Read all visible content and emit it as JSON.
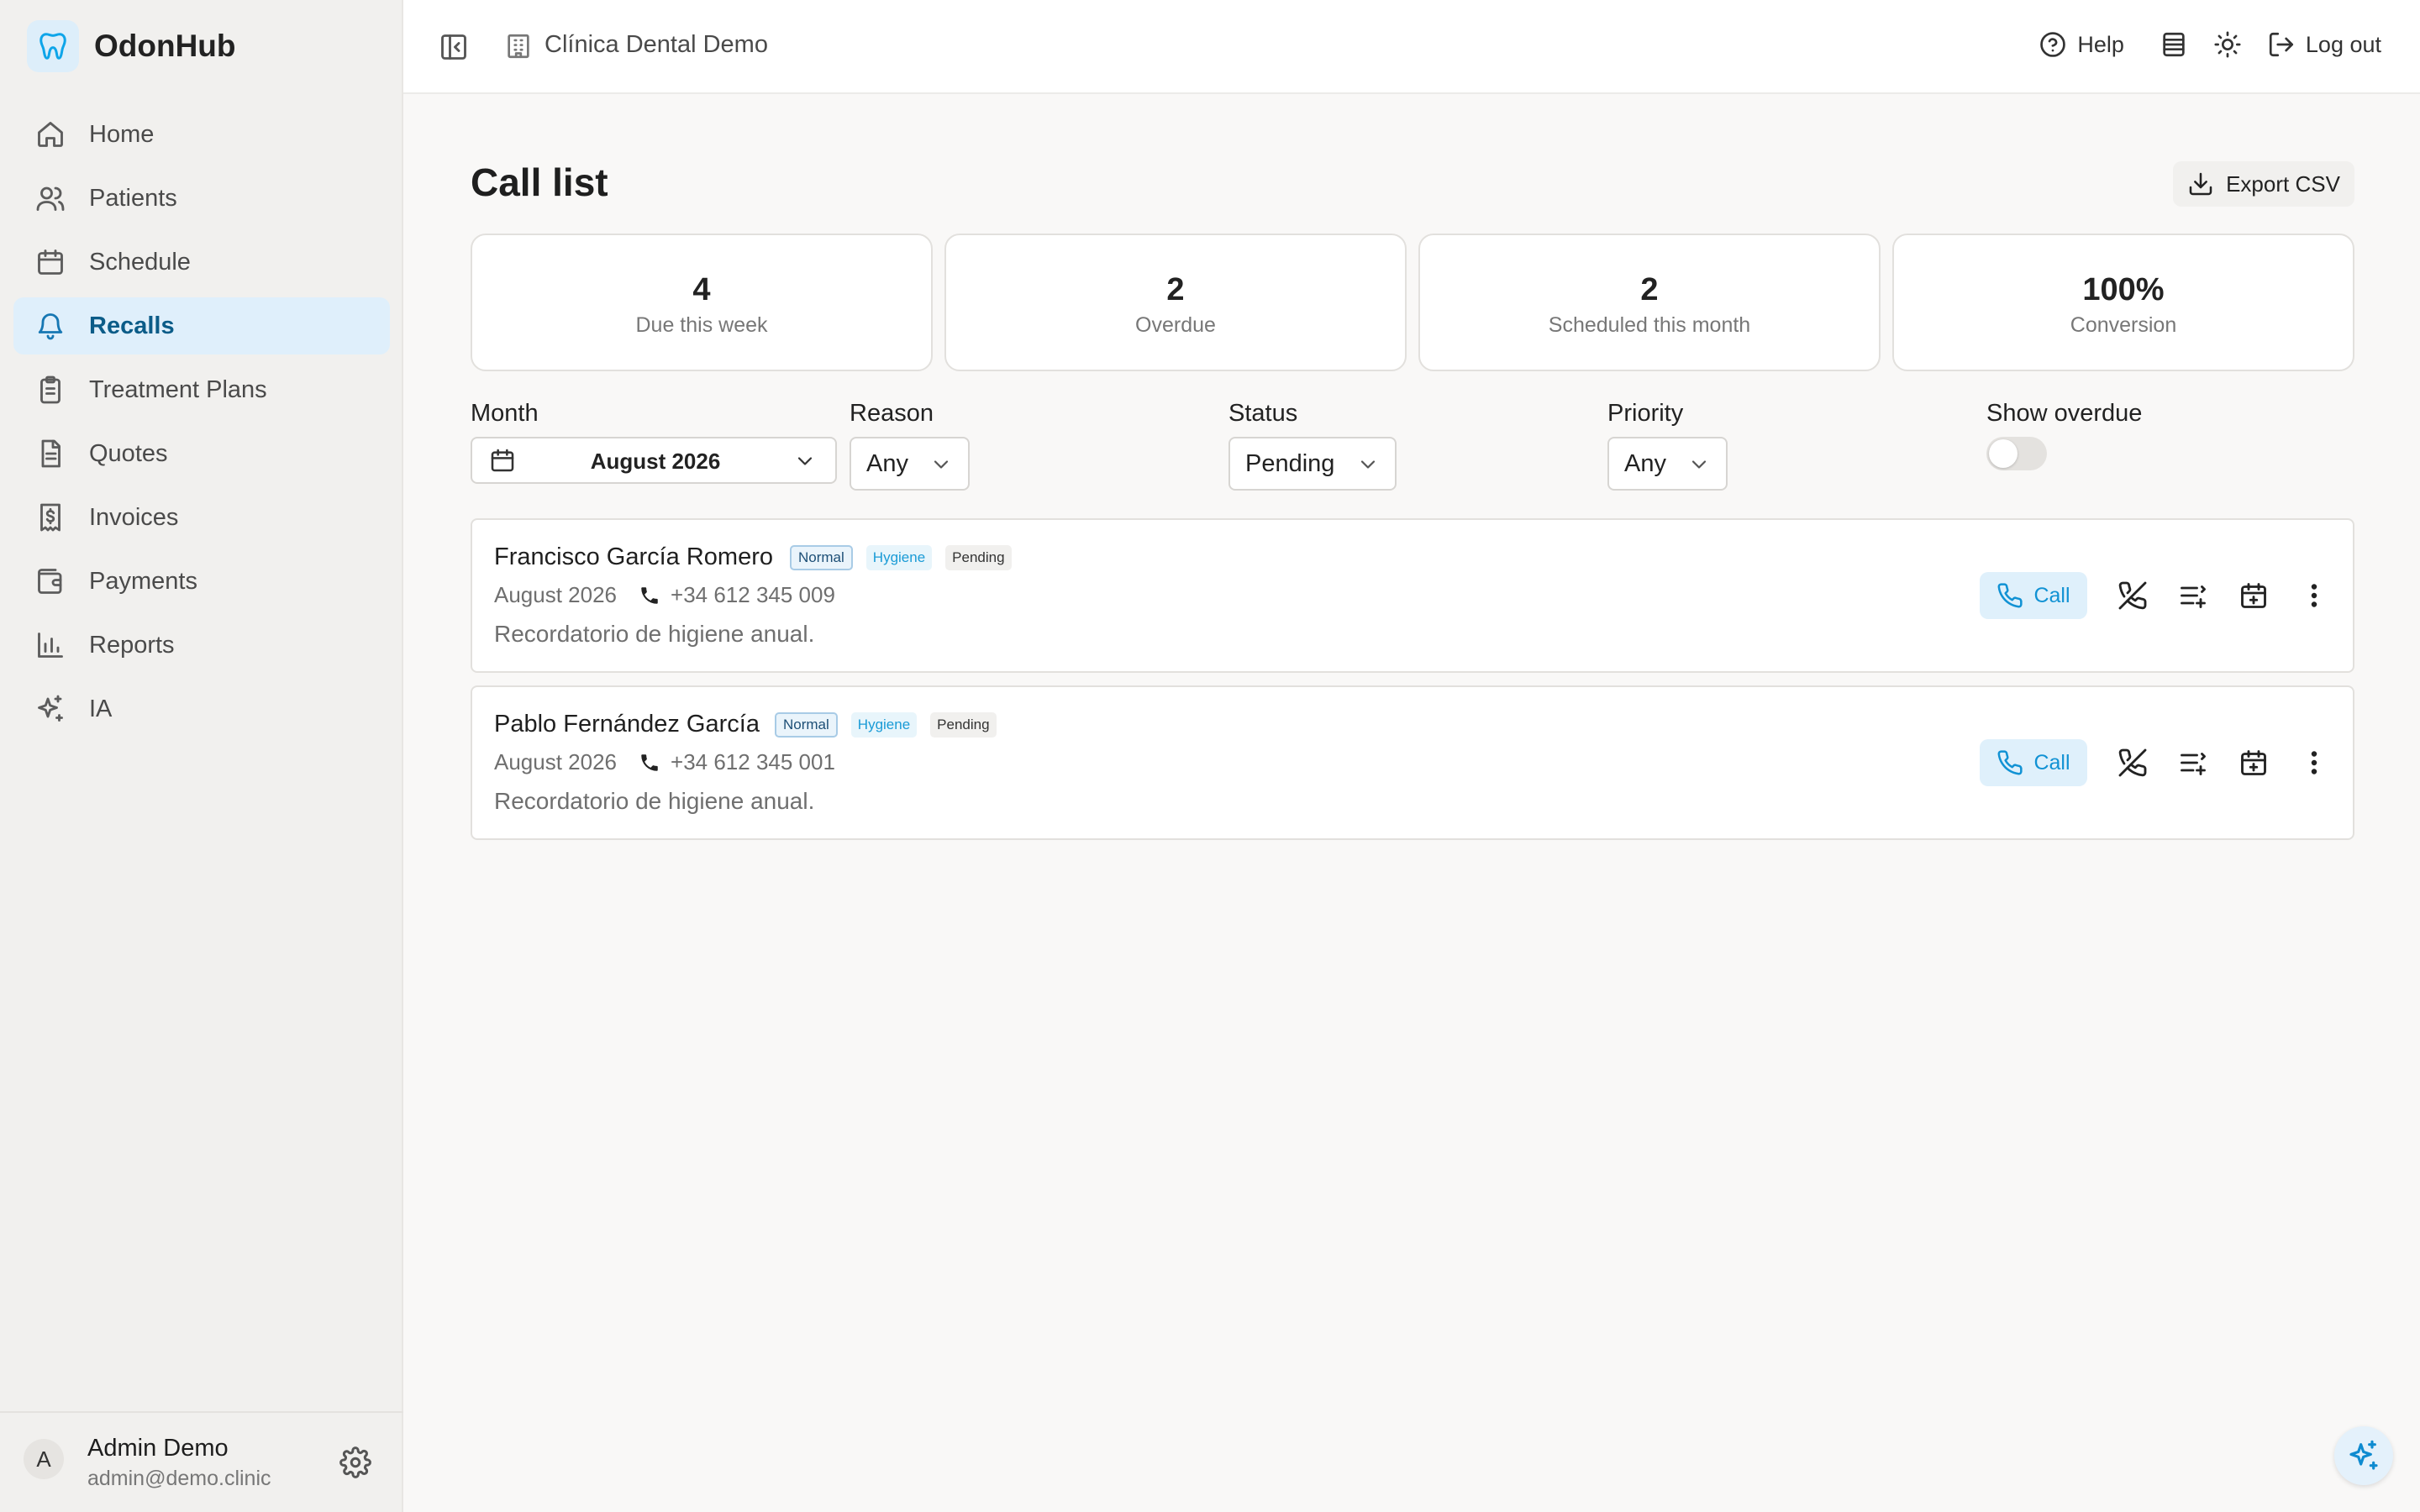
{
  "app": {
    "name": "OdonHub",
    "logo_icon": "tooth-icon",
    "accent": "#0ea5e9"
  },
  "sidebar": {
    "items": [
      {
        "label": "Home",
        "icon": "home-icon",
        "active": false
      },
      {
        "label": "Patients",
        "icon": "users-icon",
        "active": false
      },
      {
        "label": "Schedule",
        "icon": "calendar-icon",
        "active": false
      },
      {
        "label": "Recalls",
        "icon": "bell-icon",
        "active": true
      },
      {
        "label": "Treatment Plans",
        "icon": "clipboard-icon",
        "active": false
      },
      {
        "label": "Quotes",
        "icon": "document-icon",
        "active": false
      },
      {
        "label": "Invoices",
        "icon": "receipt-dollar-icon",
        "active": false
      },
      {
        "label": "Payments",
        "icon": "wallet-icon",
        "active": false
      },
      {
        "label": "Reports",
        "icon": "bar-chart-icon",
        "active": false
      },
      {
        "label": "IA",
        "icon": "sparkles-icon",
        "active": false
      }
    ],
    "user": {
      "initial": "A",
      "name": "Admin Demo",
      "email": "admin@demo.clinic"
    }
  },
  "header": {
    "clinic": "Clínica Dental Demo",
    "help_label": "Help",
    "logout_label": "Log out"
  },
  "main": {
    "title": "Call list",
    "export_label": "Export CSV",
    "stats": [
      {
        "value": "4",
        "label": "Due this week"
      },
      {
        "value": "2",
        "label": "Overdue"
      },
      {
        "value": "2",
        "label": "Scheduled this month"
      },
      {
        "value": "100%",
        "label": "Conversion"
      }
    ],
    "filters": {
      "month": {
        "label": "Month",
        "value": "August 2026"
      },
      "reason": {
        "label": "Reason",
        "value": "Any"
      },
      "status": {
        "label": "Status",
        "value": "Pending"
      },
      "priority": {
        "label": "Priority",
        "value": "Any"
      },
      "overdue": {
        "label": "Show overdue",
        "enabled": false
      }
    },
    "calls": [
      {
        "name": "Francisco García Romero",
        "priority": "Normal",
        "reason": "Hygiene",
        "status": "Pending",
        "month": "August 2026",
        "phone": "+34 612 345 009",
        "note": "Recordatorio de higiene anual."
      },
      {
        "name": "Pablo Fernández García",
        "priority": "Normal",
        "reason": "Hygiene",
        "status": "Pending",
        "month": "August 2026",
        "phone": "+34 612 345 001",
        "note": "Recordatorio de higiene anual."
      }
    ],
    "call_label": "Call"
  }
}
